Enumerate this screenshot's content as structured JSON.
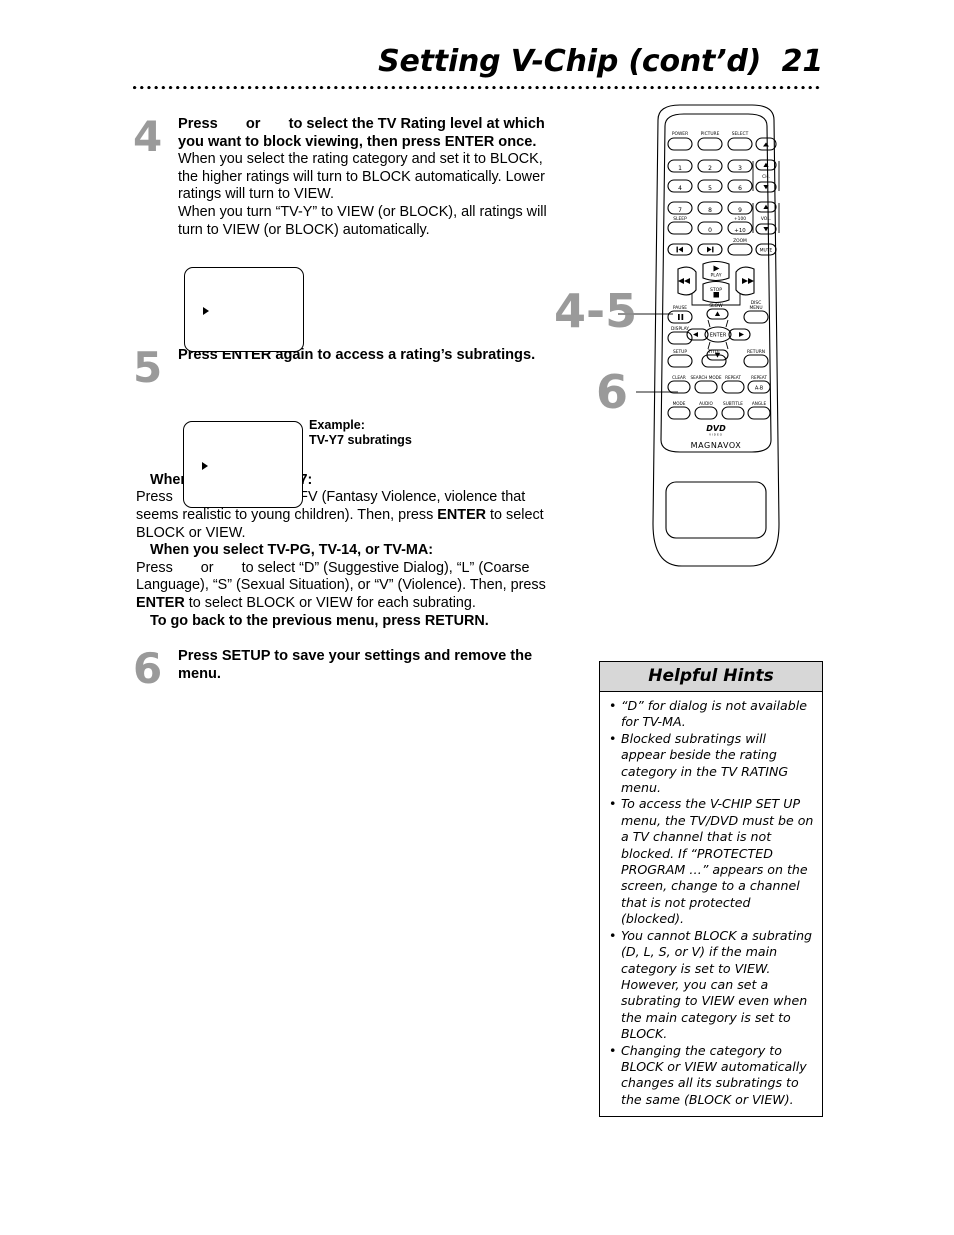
{
  "header": {
    "title": "Setting V-Chip (cont’d)  21"
  },
  "steps": [
    {
      "number": "4",
      "lead_before": "Press ",
      "lead_mid": " or ",
      "lead_after": " to select the TV Rating level at which you want to block viewing, then press ENTER once.",
      "note": "When you select the rating category and set it to BLOCK, the higher ratings will turn to BLOCK automatically. Lower ratings will turn to VIEW.\nWhen you turn “TV-Y” to VIEW (or BLOCK), all ratings will turn to VIEW (or BLOCK) automatically."
    },
    {
      "number": "5",
      "lead": "Press ENTER again to access a rating’s subratings."
    },
    {
      "number": "6",
      "lead": "Press SETUP to save your settings and remove the menu."
    }
  ],
  "example_caption": "Example:\nTV-Y7 subratings",
  "subrating_section": {
    "heading_y7": "When you select TV-Y7:",
    "body_y7_a": "Press ",
    "body_y7_b": " or ",
    "body_y7_c": " to select FV (Fantasy Violence, violence that seems realistic to young children). Then, press ",
    "body_y7_enter": "ENTER",
    "body_y7_d": " to select BLOCK or VIEW.",
    "heading_pg": "When you select TV-PG, TV-14, or TV-MA:",
    "body_pg_a": "Press ",
    "body_pg_b": " or ",
    "body_pg_c": " to select “D” (Suggestive Dialog), “L” (Coarse Language), “S” (Sexual Situation), or “V” (Violence). Then, press ",
    "body_pg_enter": "ENTER",
    "body_pg_d": " to select BLOCK or VIEW for each subrating.",
    "return_note_a": "To go back to the previous menu, press ",
    "return_note_b": "RETURN."
  },
  "callouts": {
    "steps_4_5": "4-5",
    "step_6": "6"
  },
  "helpful_hints": {
    "title": "Helpful Hints",
    "items": [
      "“D” for dialog is not available for TV-MA.",
      "Blocked subratings will appear beside the rating category in the TV RATING menu.",
      "To access the V-CHIP SET UP menu, the TV/DVD must be on a TV channel that is not blocked. If “PROTECTED PROGRAM …” appears on the screen, change to a channel that is not protected (blocked).",
      "You cannot BLOCK a subrating (D, L, S, or V) if the main category is set to VIEW. However, you can set a subrating to VIEW even when the main category is set to BLOCK.",
      "Changing the category to BLOCK or VIEW automatically changes all its subratings to the same (BLOCK or VIEW)."
    ]
  },
  "remote": {
    "brand": "MAGNAVOX",
    "logo": "DVD",
    "logo_sub": "VIDEO",
    "buttons": [
      "POWER",
      "PICTURE",
      "SELECT",
      "▲",
      "1",
      "2",
      "3",
      "CH.",
      "4",
      "5",
      "6",
      "7",
      "8",
      "9",
      "VOL.",
      "SLEEP",
      "0",
      "+100",
      "+10",
      "ZOOM",
      "MUTE",
      "PLAY",
      "STOP",
      "SLOW",
      "PAUSE",
      "DISC MENU",
      "DISPLAY",
      "ENTER",
      "SETUP",
      "TITLE",
      "RETURN",
      "CLEAR",
      "SEARCH MODE",
      "REPEAT",
      "REPEAT A-B",
      "MODE",
      "AUDIO",
      "SUBTITLE",
      "ANGLE"
    ],
    "labels": {
      "power": "POWER",
      "picture": "PICTURE",
      "select": "SELECT",
      "ch": "CH.",
      "vol": "VOL.",
      "sleep": "SLEEP",
      "plus100": "+100",
      "plus10": "+10",
      "zoom": "ZOOM",
      "mute": "MUTE",
      "play": "PLAY",
      "stop": "STOP",
      "slow": "SLOW",
      "pause": "PAUSE",
      "disc_menu_1": "DISC",
      "disc_menu_2": "MENU",
      "display": "DISPLAY",
      "enter": "ENTER",
      "setup": "SETUP",
      "title": "TITLE",
      "return": "RETURN",
      "clear": "CLEAR",
      "search_mode": "SEARCH MODE",
      "repeat": "REPEAT",
      "repeat_ab_label": "REPEAT",
      "repeat_ab": "A-B",
      "mode": "MODE",
      "audio": "AUDIO",
      "subtitle": "SUBTITLE",
      "angle": "ANGLE",
      "num1": "1",
      "num2": "2",
      "num3": "3",
      "num4": "4",
      "num5": "5",
      "num6": "6",
      "num7": "7",
      "num8": "8",
      "num9": "9",
      "num0": "0"
    }
  }
}
